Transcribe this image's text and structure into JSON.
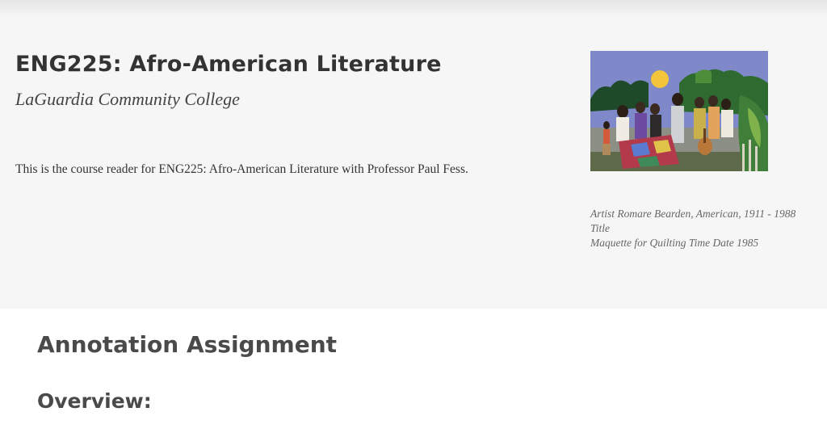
{
  "header": {
    "course_title": "ENG225: Afro-American Literature",
    "institution": "LaGuardia Community College",
    "description": "This is the course reader for ENG225: Afro-American Literature with Professor Paul Fess."
  },
  "cover_image": {
    "caption_lines": [
      "Artist Romare Bearden, American, 1911 - 1988",
      "Title",
      "Maquette for Quilting Time Date 1985"
    ]
  },
  "content": {
    "heading": "Annotation Assignment",
    "subheading": "Overview:"
  },
  "colors": {
    "hero_background": "#f6f6f6",
    "heading_text": "#333333",
    "caption_text": "#666666"
  }
}
